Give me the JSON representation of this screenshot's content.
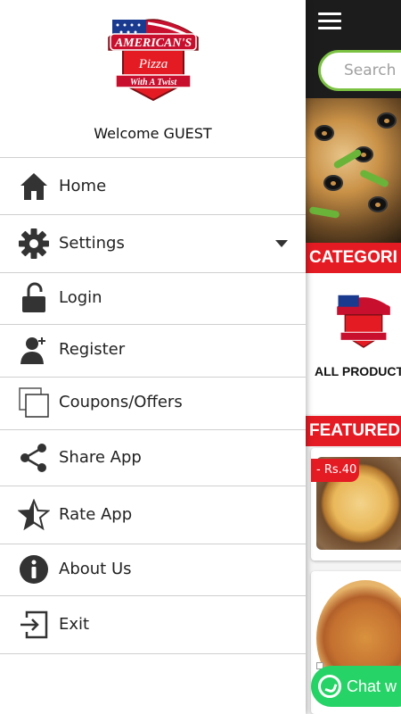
{
  "app": {
    "search_placeholder": "Search p",
    "categories_heading": "CATEGORI",
    "category_item": "ALL PRODUCTS",
    "featured_heading": "FEATURED P",
    "product_price_badge": "- Rs.40",
    "chat_button": "Chat w",
    "colors": {
      "accent_red": "#e51b24",
      "search_border": "#7cc242",
      "whatsapp_green": "#25d366",
      "topbar": "#1c1c1c"
    }
  },
  "drawer": {
    "logo": {
      "brand": "AMERICAN'S",
      "line1": "Pizza",
      "line2": "With A Twist"
    },
    "welcome_text": "Welcome GUEST",
    "items": [
      {
        "label": "Home",
        "icon": "home-icon"
      },
      {
        "label": "Settings",
        "icon": "gear-icon",
        "has_dropdown": true
      },
      {
        "label": "Login",
        "icon": "unlock-icon"
      },
      {
        "label": "Register",
        "icon": "add-user-icon"
      },
      {
        "label": "Coupons/Offers",
        "icon": "copy-icon"
      },
      {
        "label": "Share App",
        "icon": "share-icon"
      },
      {
        "label": "Rate App",
        "icon": "star-icon"
      },
      {
        "label": "About Us",
        "icon": "info-icon"
      },
      {
        "label": "Exit",
        "icon": "exit-icon"
      }
    ]
  }
}
